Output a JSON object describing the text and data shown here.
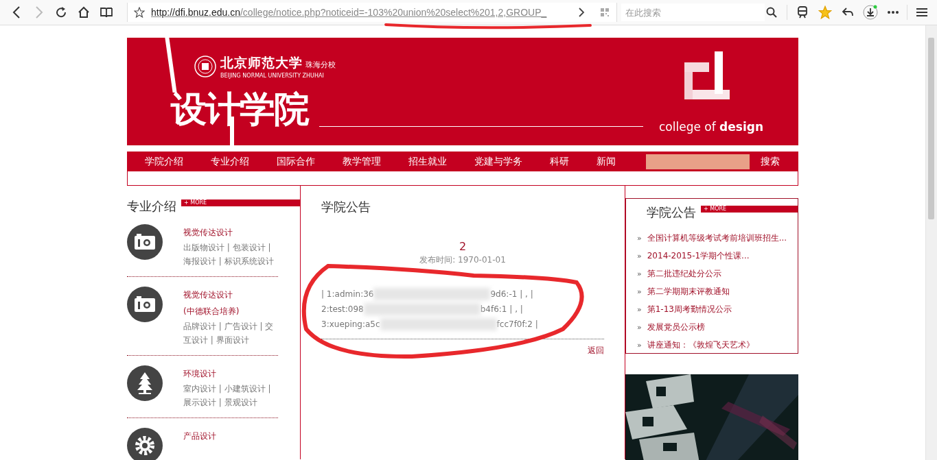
{
  "browser": {
    "url_host": "http://dfi.bnuz.edu.cn",
    "url_path": "/college/notice.php?noticeid=-103%20union%20select%201,2,GROUP_",
    "search_placeholder": "在此搜索",
    "forward_disabled": true
  },
  "header": {
    "university_cn": "北京师范大学",
    "campus": "珠海分校",
    "university_en": "BEIJING NORMAL UNIVERSITY  ZHUHAI",
    "college_cn": "设计学院",
    "college_en_light": "college of ",
    "college_en_bold": "design"
  },
  "nav": {
    "items": [
      "学院介绍",
      "专业介绍",
      "国际合作",
      "教学管理",
      "招生就业",
      "党建与学务",
      "科研",
      "新闻"
    ],
    "search_button": "搜索"
  },
  "majors": {
    "title": "专业介绍",
    "more": "+ MORE",
    "items": [
      {
        "kind": "camera",
        "titles": [
          "视觉传达设计"
        ],
        "sub": "出版物设计 | 包装设计 | 海报设计 | 标识系统设计"
      },
      {
        "kind": "camera",
        "titles": [
          "视觉传达设计",
          "(中德联合培养)"
        ],
        "sub": "品牌设计 | 广告设计 | 交互设计 | 界面设计"
      },
      {
        "kind": "tree",
        "titles": [
          "环境设计"
        ],
        "sub": "室内设计 | 小建筑设计 | 展示设计 | 景观设计"
      },
      {
        "kind": "gear",
        "titles": [
          "产品设计"
        ]
      }
    ]
  },
  "notice": {
    "section_title": "学院公告",
    "title": "2",
    "date": "发布时间: 1970-01-01",
    "lines": [
      {
        "start": "| 1:admin:36",
        "end": "9d6:-1 | , |"
      },
      {
        "start": "2:test:098",
        "end": "b4f6:1 | , |"
      },
      {
        "start": "3:xueping:a5c",
        "end": "fcc7f0f:2 |"
      }
    ],
    "back": "返回"
  },
  "announcements": {
    "title": "学院公告",
    "more": "+ MORE",
    "bullet": "»",
    "items": [
      "全国计算机等级考试考前培训班招生...",
      "2014-2015-1学期个性课...",
      "第二批违纪处分公示",
      "第二学期期末评教通知",
      "第1-13周考勤情况公示",
      "发展党员公示榜",
      "讲座通知：《敦煌飞天艺术》"
    ]
  }
}
